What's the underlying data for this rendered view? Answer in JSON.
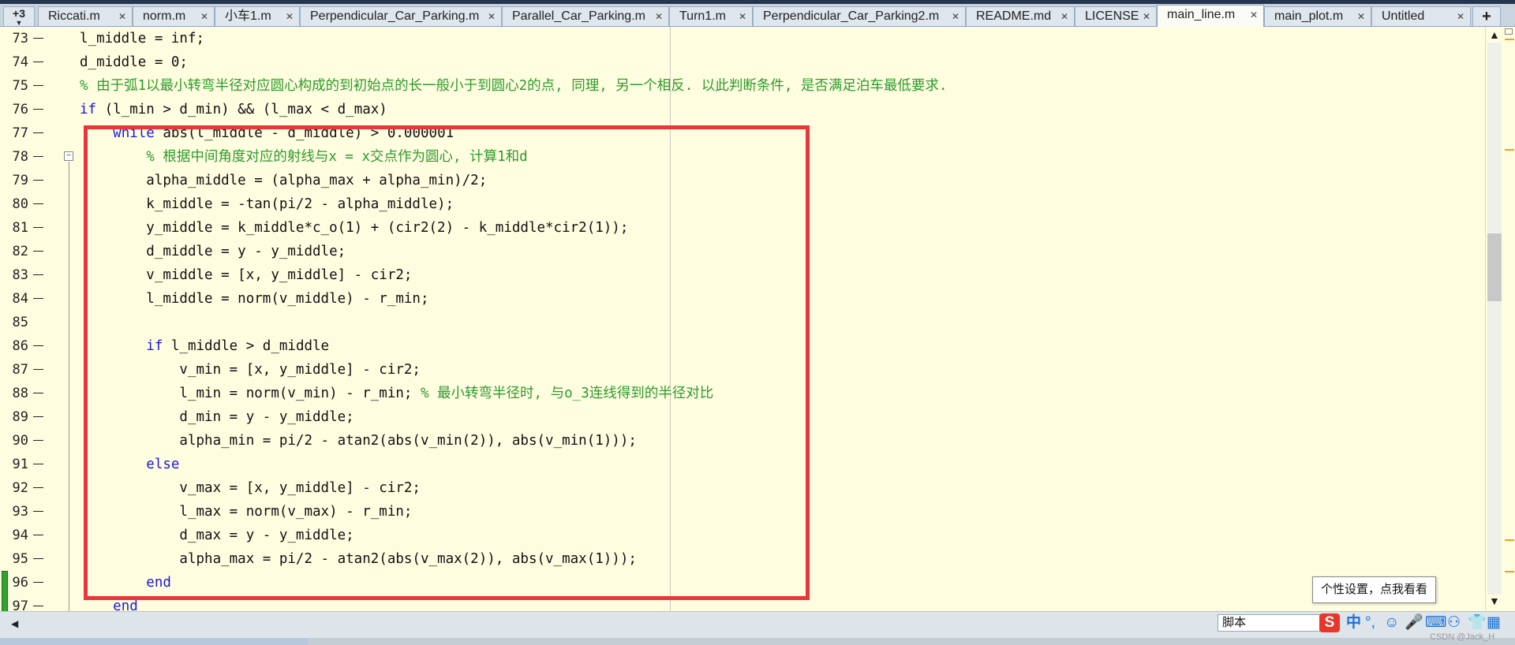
{
  "tabs": {
    "more_label": "+3",
    "items": [
      {
        "label": "Riccati.m"
      },
      {
        "label": "norm.m"
      },
      {
        "label": "小车1.m"
      },
      {
        "label": "Perpendicular_Car_Parking.m"
      },
      {
        "label": "Parallel_Car_Parking.m"
      },
      {
        "label": "Turn1.m"
      },
      {
        "label": "Perpendicular_Car_Parking2.m"
      },
      {
        "label": "README.md"
      },
      {
        "label": "LICENSE"
      },
      {
        "label": "main_line.m"
      },
      {
        "label": "main_plot.m"
      },
      {
        "label": "Untitled"
      }
    ],
    "add_label": "+"
  },
  "editor": {
    "lines": [
      {
        "num": "73",
        "code": "l_middle = inf;"
      },
      {
        "num": "74",
        "code": "d_middle = 0;"
      },
      {
        "num": "75",
        "code": "% 由于弧1以最小转弯半径对应圆心构成的到初始点的长一般小于到圆心2的点, 同理, 另一个相反. 以此判断条件, 是否满足泊车最低要求."
      },
      {
        "num": "76",
        "code": "if (l_min > d_min) && (l_max < d_max)"
      },
      {
        "num": "77",
        "code": "    while abs(l_middle - d_middle) > 0.000001"
      },
      {
        "num": "78",
        "code": "        % 根据中间角度对应的射线与x = x交点作为圆心, 计算1和d"
      },
      {
        "num": "79",
        "code": "        alpha_middle = (alpha_max + alpha_min)/2;"
      },
      {
        "num": "80",
        "code": "        k_middle = -tan(pi/2 - alpha_middle);"
      },
      {
        "num": "81",
        "code": "        y_middle = k_middle*c_o(1) + (cir2(2) - k_middle*cir2(1));"
      },
      {
        "num": "82",
        "code": "        d_middle = y - y_middle;"
      },
      {
        "num": "83",
        "code": "        v_middle = [x, y_middle] - cir2;"
      },
      {
        "num": "84",
        "code": "        l_middle = norm(v_middle) - r_min;"
      },
      {
        "num": "85",
        "code": ""
      },
      {
        "num": "86",
        "code": "        if l_middle > d_middle"
      },
      {
        "num": "87",
        "code": "            v_min = [x, y_middle] - cir2;"
      },
      {
        "num": "88",
        "code": "            l_min = norm(v_min) - r_min; % 最小转弯半径时, 与o_3连线得到的半径对比"
      },
      {
        "num": "89",
        "code": "            d_min = y - y_middle;"
      },
      {
        "num": "90",
        "code": "            alpha_min = pi/2 - atan2(abs(v_min(2)), abs(v_min(1)));"
      },
      {
        "num": "91",
        "code": "        else"
      },
      {
        "num": "92",
        "code": "            v_max = [x, y_middle] - cir2;"
      },
      {
        "num": "93",
        "code": "            l_max = norm(v_max) - r_min;"
      },
      {
        "num": "94",
        "code": "            d_max = y - y_middle;"
      },
      {
        "num": "95",
        "code": "            alpha_max = pi/2 - atan2(abs(v_max(2)), abs(v_max(1)));"
      },
      {
        "num": "96",
        "code": "        end"
      },
      {
        "num": "97",
        "code": "    end"
      }
    ]
  },
  "status": {
    "ime_text": "脚本",
    "tooltip": "个性设置，点我看看",
    "watermark": "CSDN @Jack_H"
  },
  "colors": {
    "editor_bg": "#fffde0",
    "keyword": "#1a1ae0",
    "comment": "#2b9b2b",
    "highlight_box": "#e8363a"
  }
}
